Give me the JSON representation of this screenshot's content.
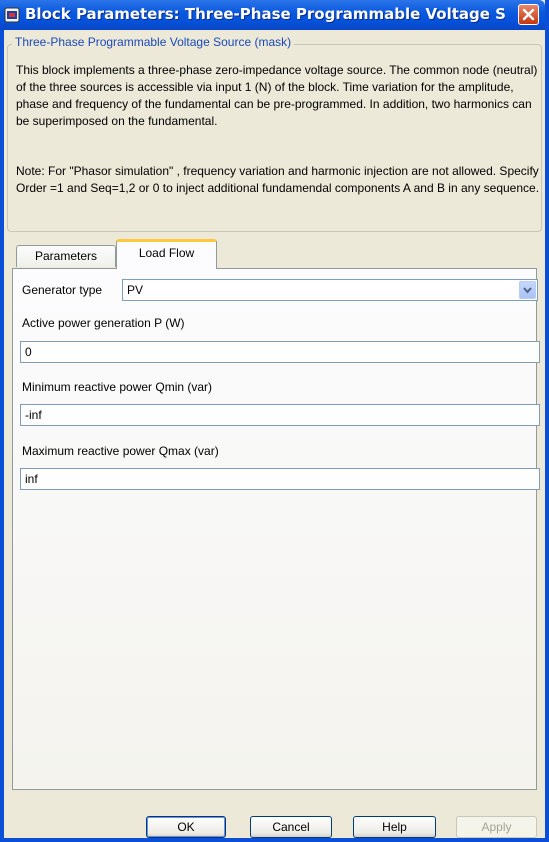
{
  "window": {
    "title": "Block Parameters: Three-Phase Programmable Voltage Sou...",
    "close_icon": "close-icon",
    "app_icon": "simulink-block-icon"
  },
  "mask": {
    "legend": "Three-Phase Programmable Voltage Source (mask)",
    "description": "This block implements a three-phase zero-impedance voltage source. The common node (neutral) of the three sources is accessible via input 1 (N) of the block. Time variation for the amplitude, phase and frequency of the fundamental can be pre-programmed. In addition, two harmonics can be superimposed on the fundamental.",
    "note": "Note: For  \"Phasor simulation\" , frequency variation and harmonic injection are not allowed.  Specify  Order =1 and Seq=1,2 or 0 to inject additional fundamendal components A and B in  any sequence."
  },
  "tabs": [
    {
      "label": "Parameters",
      "active": false
    },
    {
      "label": "Load Flow",
      "active": true
    }
  ],
  "load_flow": {
    "generator_type_label": "Generator type",
    "generator_type_value": "PV",
    "active_power_label": "Active power generation P (W)",
    "active_power_value": "0",
    "qmin_label": "Minimum reactive power Qmin (var)",
    "qmin_value": "-inf",
    "qmax_label": "Maximum reactive power Qmax (var)",
    "qmax_value": "inf"
  },
  "buttons": {
    "ok": "OK",
    "cancel": "Cancel",
    "help": "Help",
    "apply": "Apply"
  },
  "colors": {
    "title_bar": "#0a4fd6",
    "active_tab_accent": "#ffc73c",
    "legend_text": "#1b49b8"
  }
}
